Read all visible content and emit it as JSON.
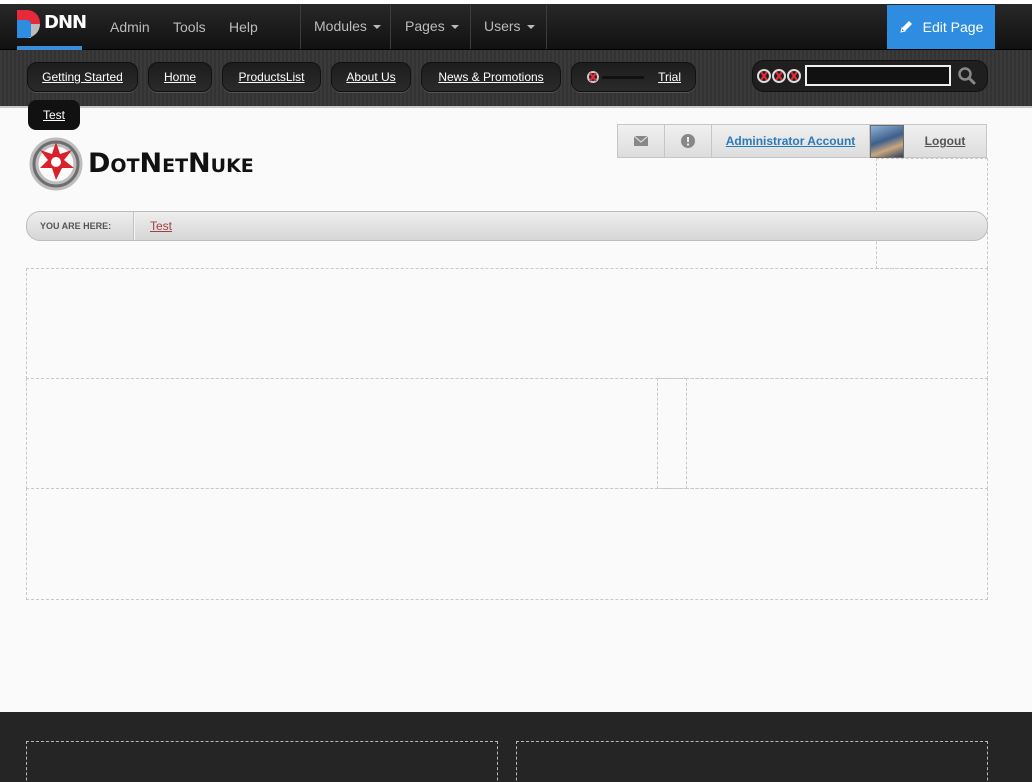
{
  "control_bar": {
    "brand": "DNN",
    "menu": [
      "Admin",
      "Tools",
      "Help"
    ],
    "dropdowns": [
      "Modules",
      "Pages",
      "Users"
    ],
    "edit_page": "Edit Page",
    "accent_color": "#2e8de0"
  },
  "nav": {
    "items": [
      "Getting Started",
      "Home",
      "ProductsList",
      "About Us",
      "News & Promotions",
      "Trial",
      "Test"
    ]
  },
  "search": {
    "value": "",
    "icon": "search-icon"
  },
  "site": {
    "logo_text": "DotNetNuke"
  },
  "user_bar": {
    "messages_icon": "envelope-icon",
    "notifications_icon": "alert-icon",
    "user_name": "Administrator Account",
    "logout": "Logout"
  },
  "breadcrumb": {
    "label": "YOU ARE HERE:",
    "current": "Test"
  }
}
